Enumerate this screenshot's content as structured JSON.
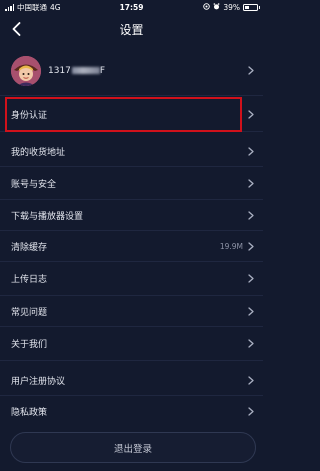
{
  "status_bar": {
    "carrier": "中国联通",
    "network": "4G",
    "time": "17:59",
    "battery": "39%",
    "battery_level": 0.39
  },
  "nav": {
    "title": "设置",
    "back_icon": "chevron-left-icon"
  },
  "profile": {
    "name_prefix": "1317",
    "name_suffix": "F"
  },
  "settings": {
    "identity": "身份认证",
    "address": "我的收货地址",
    "account_security": "账号与安全",
    "download_player": "下载与播放器设置",
    "clear_cache": "清除缓存",
    "cache_size": "19.9M",
    "upload_log": "上传日志",
    "faq": "常见问题",
    "about": "关于我们",
    "user_agreement": "用户注册协议",
    "privacy": "隐私政策"
  },
  "logout_label": "退出登录",
  "colors": {
    "background": "#131a2e",
    "divider": "#1f2740",
    "highlight": "#d0111b",
    "text": "#e4e7ef"
  }
}
